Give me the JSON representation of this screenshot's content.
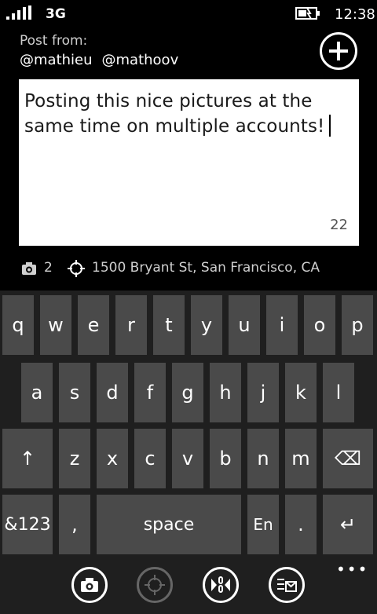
{
  "status_bar": {
    "network": "3G",
    "time": "12:38",
    "signal_icon": "signal-bars-icon",
    "battery_icon": "battery-charging-icon"
  },
  "post": {
    "from_label": "Post from:",
    "accounts": [
      "@mathieu",
      "@mathoov"
    ],
    "text": "Posting this nice pictures at the same time on multiple accounts!",
    "char_count": "22",
    "photo_count": "2",
    "location": "1500 Bryant St, San Francisco, CA"
  },
  "keyboard": {
    "row1": [
      "q",
      "w",
      "e",
      "r",
      "t",
      "y",
      "u",
      "i",
      "o",
      "p"
    ],
    "row2": [
      "a",
      "s",
      "d",
      "f",
      "g",
      "h",
      "j",
      "k",
      "l"
    ],
    "row3_letters": [
      "z",
      "x",
      "c",
      "v",
      "b",
      "n",
      "m"
    ],
    "shift_label": "↑",
    "backspace_label": "⌫",
    "numbers_label": "&123",
    "comma_label": ",",
    "space_label": "space",
    "lang_label": "En",
    "period_label": ".",
    "enter_label": "↵"
  },
  "app_bar": {
    "more_label": "•••",
    "buttons": [
      "camera-icon",
      "location-crosshair-icon",
      "share-link-icon",
      "post-send-icon"
    ]
  },
  "colors": {
    "background": "#000000",
    "keyboard_bg": "#1f1f1f",
    "key": "#4a4a4a",
    "compose_bg": "#ffffff"
  }
}
